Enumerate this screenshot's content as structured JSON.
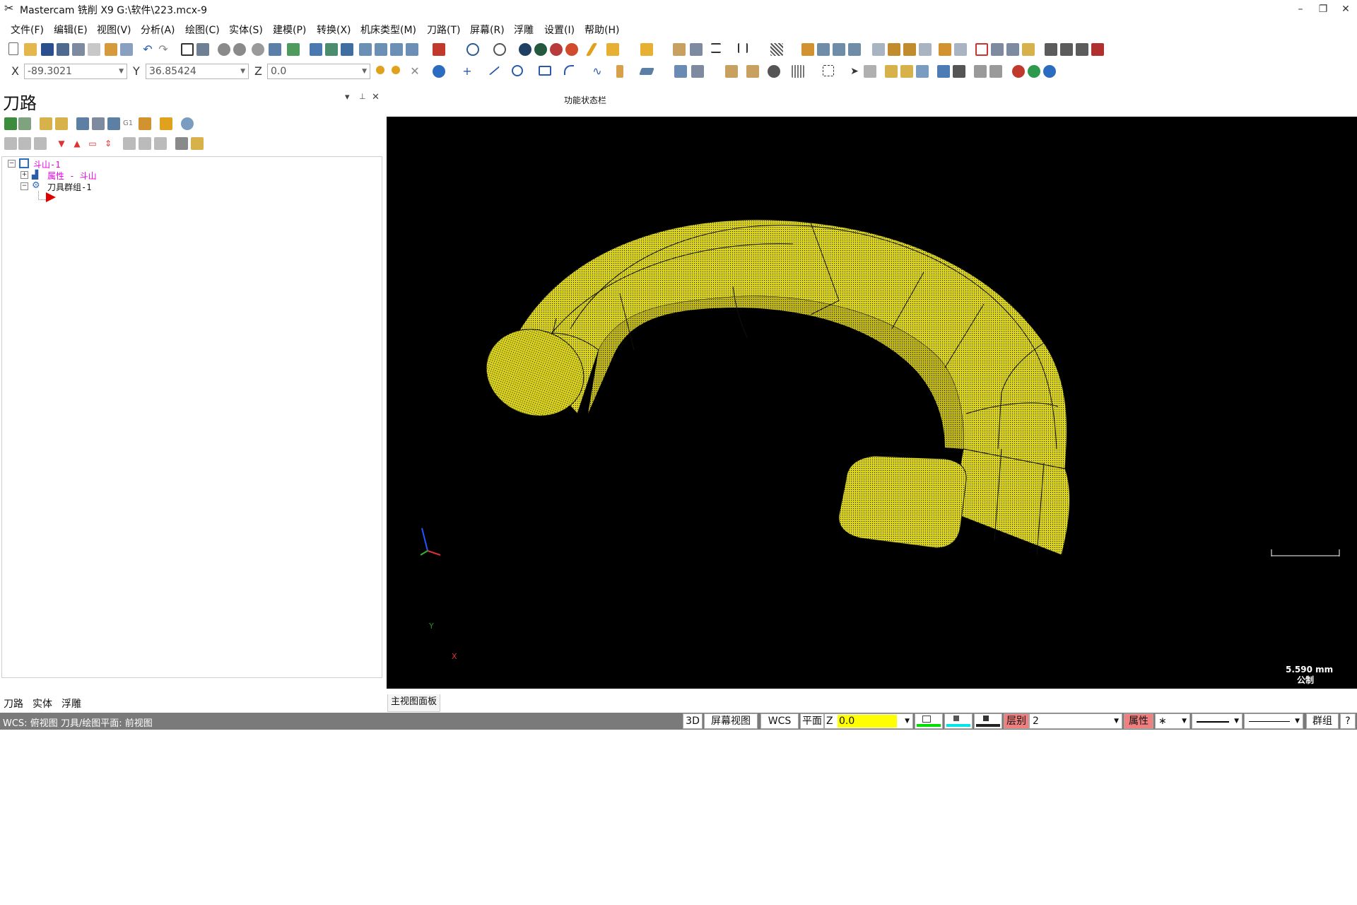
{
  "window": {
    "title": "Mastercam 铣削 X9  G:\\软件\\223.mcx-9",
    "logo_icon": "mastercam-logo-icon",
    "min": "–",
    "restore": "❐",
    "close": "✕"
  },
  "menu": [
    "文件(F)",
    "编辑(E)",
    "视图(V)",
    "分析(A)",
    "绘图(C)",
    "实体(S)",
    "建模(P)",
    "转换(X)",
    "机床类型(M)",
    "刀路(T)",
    "屏幕(R)",
    "浮雕",
    "设置(I)",
    "帮助(H)"
  ],
  "coords": {
    "x_label": "X",
    "x_value": "-89.3021",
    "y_label": "Y",
    "y_value": "36.85424",
    "z_label": "Z",
    "z_value": "0.0"
  },
  "panel": {
    "title": "刀路",
    "pin": "📌",
    "dropdown": "▾",
    "close": "✕",
    "tree": {
      "root": "斗山-1",
      "props": "属性 - 斗山",
      "toolgroup": "刀具群组-1"
    },
    "tabs": [
      "刀路",
      "实体",
      "浮雕"
    ]
  },
  "function_status": "功能状态栏",
  "viewport": {
    "axis_y": "Y",
    "axis_x": "X",
    "scale_value": "5.590 mm",
    "scale_unit": "公制",
    "background": "#000000",
    "part_color": "#d9d21e"
  },
  "viewport_tab": "主视图面板",
  "status": {
    "text": "WCS: 俯视图  刀具/绘图平面: 前视图",
    "btn_3d": "3D",
    "btn_screenview": "屏幕视图",
    "btn_wcs": "WCS",
    "btn_plane": "平面",
    "z_label": "Z",
    "z_value": "0.0",
    "level_label": "层别",
    "level_value": "2",
    "attr_label": "属性",
    "attr_value": "∗",
    "group_label": "群组",
    "help": "?"
  }
}
